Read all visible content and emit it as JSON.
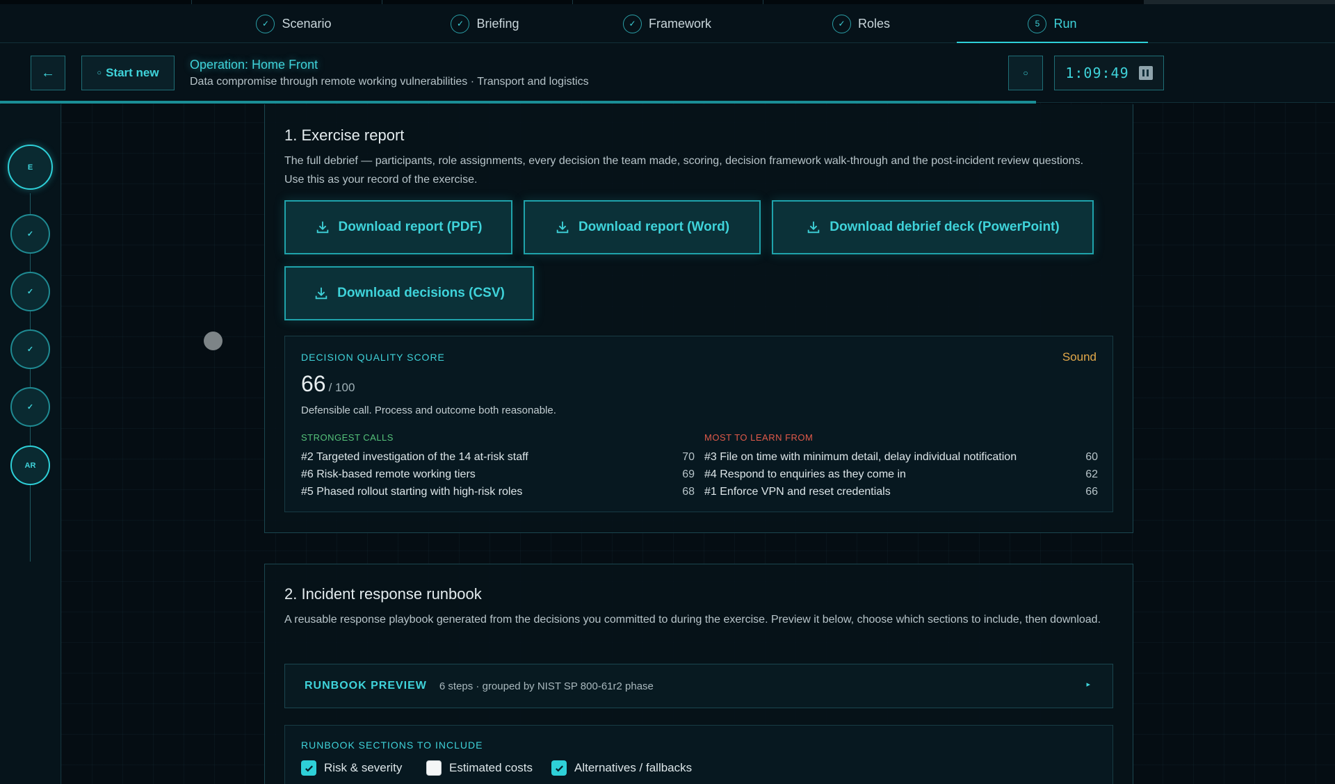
{
  "steps": [
    {
      "label": "Scenario",
      "marker": "✓"
    },
    {
      "label": "Briefing",
      "marker": "✓"
    },
    {
      "label": "Framework",
      "marker": "✓"
    },
    {
      "label": "Roles",
      "marker": "✓"
    },
    {
      "label": "Run",
      "marker": "5"
    }
  ],
  "header": {
    "back_icon": "←",
    "start_new_icon": "○",
    "start_new_label": "Start new",
    "title": "Operation: Home Front",
    "subtitle": "Data compromise through remote working vulnerabilities · Transport and logistics",
    "refresh_icon": "○",
    "timer": "1:09:49"
  },
  "rail": {
    "nodes": [
      "E",
      "✓",
      "✓",
      "✓",
      "✓",
      "AR"
    ]
  },
  "report": {
    "title": "1. Exercise report",
    "description": "The full debrief — participants, role assignments, every decision the team made, scoring, decision framework walk-through and the post-incident review questions. Use this as your record of the exercise.",
    "buttons": [
      "Download report (PDF)",
      "Download report (Word)",
      "Download debrief deck (PowerPoint)",
      "Download decisions (CSV)"
    ],
    "score": {
      "label": "DECISION QUALITY SCORE",
      "badge": "Sound",
      "value": "66",
      "out_of": "/ 100",
      "note": "Defensible call. Process and outcome both reasonable.",
      "strongest_title": "STRONGEST CALLS",
      "strongest": [
        {
          "label": "#2 Targeted investigation of the 14 at-risk staff",
          "value": "70"
        },
        {
          "label": "#6 Risk-based remote working tiers",
          "value": "69"
        },
        {
          "label": "#5 Phased rollout starting with high-risk roles",
          "value": "68"
        }
      ],
      "learn_title": "MOST TO LEARN FROM",
      "learn": [
        {
          "label": "#3 File on time with minimum detail, delay individual notification",
          "value": "60"
        },
        {
          "label": "#4 Respond to enquiries as they come in",
          "value": "62"
        },
        {
          "label": "#1 Enforce VPN and reset credentials",
          "value": "66"
        }
      ]
    }
  },
  "runbook": {
    "title": "2. Incident response runbook",
    "description": "A reusable response playbook generated from the decisions you committed to during the exercise. Preview it below, choose which sections to include, then download.",
    "preview_title": "RUNBOOK PREVIEW",
    "preview_meta": "6 steps · grouped by NIST SP 800-61r2 phase",
    "preview_arrow": "▸",
    "sections_title": "RUNBOOK SECTIONS TO INCLUDE",
    "sections": [
      {
        "label": "Risk & severity",
        "checked": true
      },
      {
        "label": "Estimated costs",
        "checked": false
      },
      {
        "label": "Alternatives / fallbacks",
        "checked": true
      }
    ]
  },
  "colors": {
    "accent": "#2ed0d8",
    "badge_sound": "#e3a94a",
    "strong": "#55c37a",
    "learn": "#e05a4a"
  }
}
